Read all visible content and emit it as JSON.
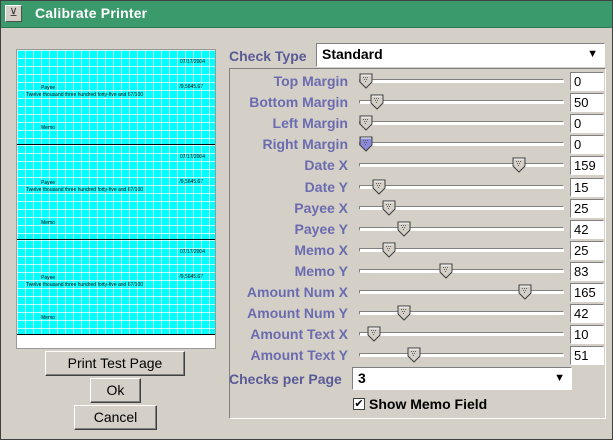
{
  "window": {
    "title": "Calibrate Printer"
  },
  "preview": {
    "checks": [
      {
        "date": "07/17/2004",
        "amount": "/9,5645.67",
        "payee": "Payee",
        "amount_text": "Twelve thousand three hundred forty-five and 67/100",
        "memo": "Memo"
      },
      {
        "date": "07/17/2004",
        "amount": "/9,5645.67",
        "payee": "Payee",
        "amount_text": "Twelve thousand three hundred forty-five and 67/100",
        "memo": "Memo"
      },
      {
        "date": "07/17/2004",
        "amount": "/9,5645.67",
        "payee": "Payee",
        "amount_text": "Twelve thousand three hundred forty-five and 67/100",
        "memo": "Memo"
      }
    ]
  },
  "buttons": {
    "print_test": "Print Test Page",
    "ok": "Ok",
    "cancel": "Cancel"
  },
  "check_type": {
    "label": "Check Type",
    "value": "Standard"
  },
  "sliders": [
    {
      "label": "Top Margin",
      "value": "0",
      "fraction": 0.0
    },
    {
      "label": "Bottom Margin",
      "value": "50",
      "fraction": 0.06
    },
    {
      "label": "Left Margin",
      "value": "0",
      "fraction": 0.0
    },
    {
      "label": "Right Margin",
      "value": "0",
      "fraction": 0.0,
      "active": true
    },
    {
      "label": "Date X",
      "value": "159",
      "fraction": 0.8
    },
    {
      "label": "Date Y",
      "value": "15",
      "fraction": 0.07
    },
    {
      "label": "Payee X",
      "value": "25",
      "fraction": 0.12
    },
    {
      "label": "Payee Y",
      "value": "42",
      "fraction": 0.2
    },
    {
      "label": "Memo X",
      "value": "25",
      "fraction": 0.12
    },
    {
      "label": "Memo Y",
      "value": "83",
      "fraction": 0.42
    },
    {
      "label": "Amount Num X",
      "value": "165",
      "fraction": 0.83
    },
    {
      "label": "Amount Num Y",
      "value": "42",
      "fraction": 0.2
    },
    {
      "label": "Amount Text X",
      "value": "10",
      "fraction": 0.04
    },
    {
      "label": "Amount Text Y",
      "value": "51",
      "fraction": 0.25
    }
  ],
  "checks_per_page": {
    "label": "Checks per Page",
    "value": "3"
  },
  "show_memo": {
    "label": "Show Memo Field",
    "checked": true,
    "mark": "✔"
  },
  "colors": {
    "title_bar": "#3a9a6c",
    "preview_fill": "#00ffff",
    "label": "#6b6bb0",
    "thumb_active": "#8a8ad8"
  }
}
